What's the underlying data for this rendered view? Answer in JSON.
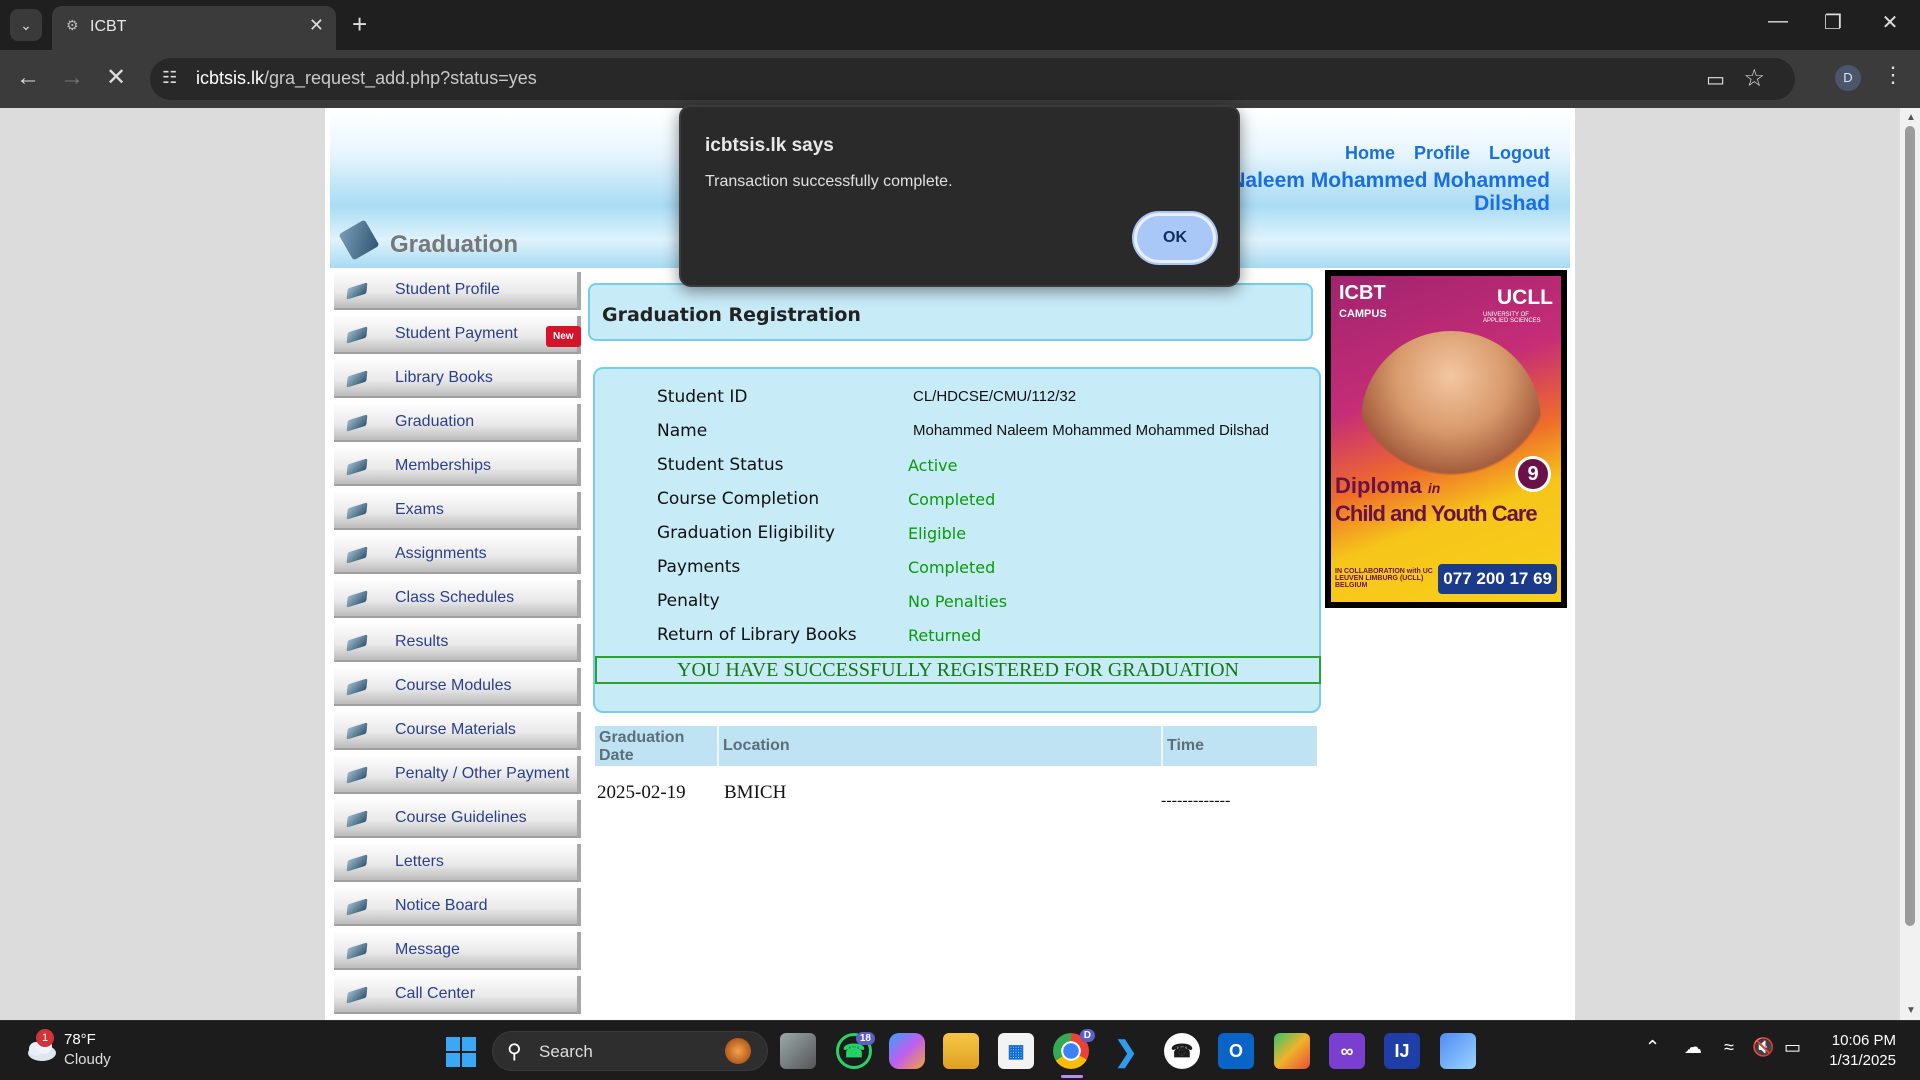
{
  "browser": {
    "tab_title": "ICBT",
    "url_host": "icbtsis.lk",
    "url_path": "/gra_request_add.php?status=yes",
    "profile_initial": "D"
  },
  "header": {
    "links": [
      "Home",
      "Profile",
      "Logout"
    ],
    "student_name": "Naleem Mohammed Mohammed Dilshad",
    "section_title": "Graduation"
  },
  "sidebar": {
    "items": [
      {
        "label": "Student Profile"
      },
      {
        "label": "Student Payment",
        "badge": "New"
      },
      {
        "label": "Library Books"
      },
      {
        "label": "Graduation"
      },
      {
        "label": "Memberships"
      },
      {
        "label": "Exams"
      },
      {
        "label": "Assignments"
      },
      {
        "label": "Class Schedules"
      },
      {
        "label": "Results"
      },
      {
        "label": "Course Modules"
      },
      {
        "label": "Course Materials"
      },
      {
        "label": "Penalty / Other Payment"
      },
      {
        "label": "Course Guidelines"
      },
      {
        "label": "Letters"
      },
      {
        "label": "Notice Board"
      },
      {
        "label": "Message"
      },
      {
        "label": "Call Center"
      }
    ]
  },
  "registration": {
    "title": "Graduation Registration",
    "rows": [
      {
        "label": "Student ID",
        "value": "CL/HDCSE/CMU/112/32"
      },
      {
        "label": "Name",
        "value": "Mohammed Naleem Mohammed Mohammed Dilshad"
      },
      {
        "label": "Student Status",
        "value": "Active"
      },
      {
        "label": "Course Completion",
        "value": "Completed"
      },
      {
        "label": "Graduation Eligibility",
        "value": "Eligible"
      },
      {
        "label": "Payments",
        "value": "Completed"
      },
      {
        "label": "Penalty",
        "value": "No Penalties"
      },
      {
        "label": "Return of Library Books",
        "value": "Returned"
      }
    ],
    "success_message": "YOU HAVE SUCCESSFULLY REGISTERED FOR GRADUATION"
  },
  "graduation_table": {
    "headers": {
      "date": "Graduation Date",
      "location": "Location",
      "time": "Time"
    },
    "row": {
      "date": "2025-02-19",
      "location": "BMICH",
      "time": "-------------"
    }
  },
  "ad": {
    "brand_left": "ICBT",
    "brand_left_sub": "CAMPUS",
    "brand_right": "UCLL",
    "brand_right_sub": "UNIVERSITY OF APPLIED SCIENCES",
    "diploma": "Diploma",
    "diploma_in": "in",
    "course": "Child and Youth Care",
    "months": "9",
    "collab": "IN COLLABORATION with UC LEUVEN LIMBURG (UCLL) BELGIUM",
    "phone": "077 200 17 69"
  },
  "alert": {
    "title": "icbtsis.lk says",
    "message": "Transaction successfully complete.",
    "ok_label": "OK"
  },
  "taskbar": {
    "weather_badge": "1",
    "temperature": "78°F",
    "condition": "Cloudy",
    "search_label": "Search",
    "whatsapp_badge": "18",
    "chrome_badge": "D",
    "time": "10:06 PM",
    "date": "1/31/2025"
  }
}
